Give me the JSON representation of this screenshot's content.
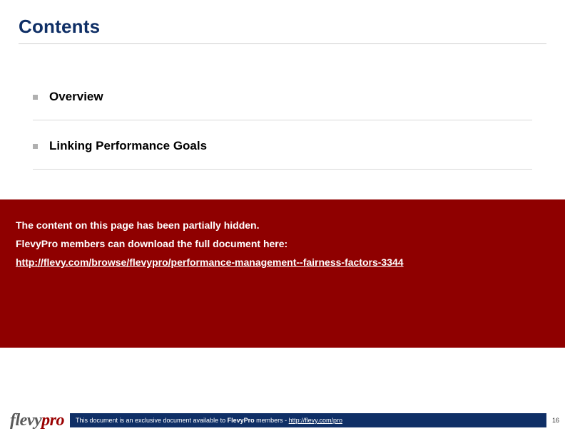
{
  "title": "Contents",
  "toc": {
    "items": [
      {
        "label": "Overview"
      },
      {
        "label": "Linking Performance Goals"
      }
    ]
  },
  "notice": {
    "line1": "The content on this page has been partially hidden.",
    "line2": "FlevyPro members can download the full document here:",
    "link_text": "http://flevy.com/browse/flevypro/performance-management--fairness-factors-3344"
  },
  "footer": {
    "logo_part1": "flevy",
    "logo_part2": "pro",
    "msg_prefix": "This document is an exclusive document available to ",
    "msg_brand": "FlevyPro",
    "msg_mid": " members - ",
    "msg_link": "http://flevy.com/pro",
    "page_number": "16"
  }
}
